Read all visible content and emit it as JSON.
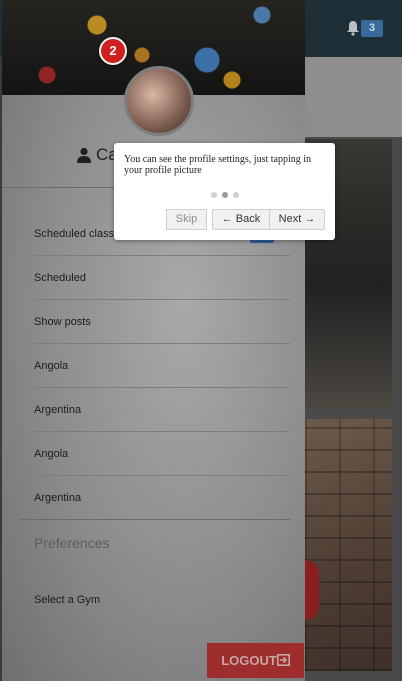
{
  "topbar": {
    "notification_count": "3",
    "bell_icon": "bell-icon"
  },
  "drawer": {
    "username": "Ca",
    "menu": [
      {
        "label": "Scheduled class"
      },
      {
        "label": "Scheduled"
      },
      {
        "label": "Show posts"
      },
      {
        "label": "Angola"
      },
      {
        "label": "Argentina"
      },
      {
        "label": "Angola"
      },
      {
        "label": "Argentina"
      }
    ],
    "preferences_title": "Preferences",
    "select_gym": "Select a Gym",
    "logout_label": "LOGOUT"
  },
  "tour": {
    "step": "2",
    "text": "You can see the profile settings, just tapping in your profile picture",
    "skip": "Skip",
    "back": "← Back",
    "next": "Next →"
  },
  "colors": {
    "accent": "#cf1f1f",
    "toggle": "#2f5d9b",
    "logout": "#9e2d2d",
    "topbar": "#1f2f37"
  }
}
